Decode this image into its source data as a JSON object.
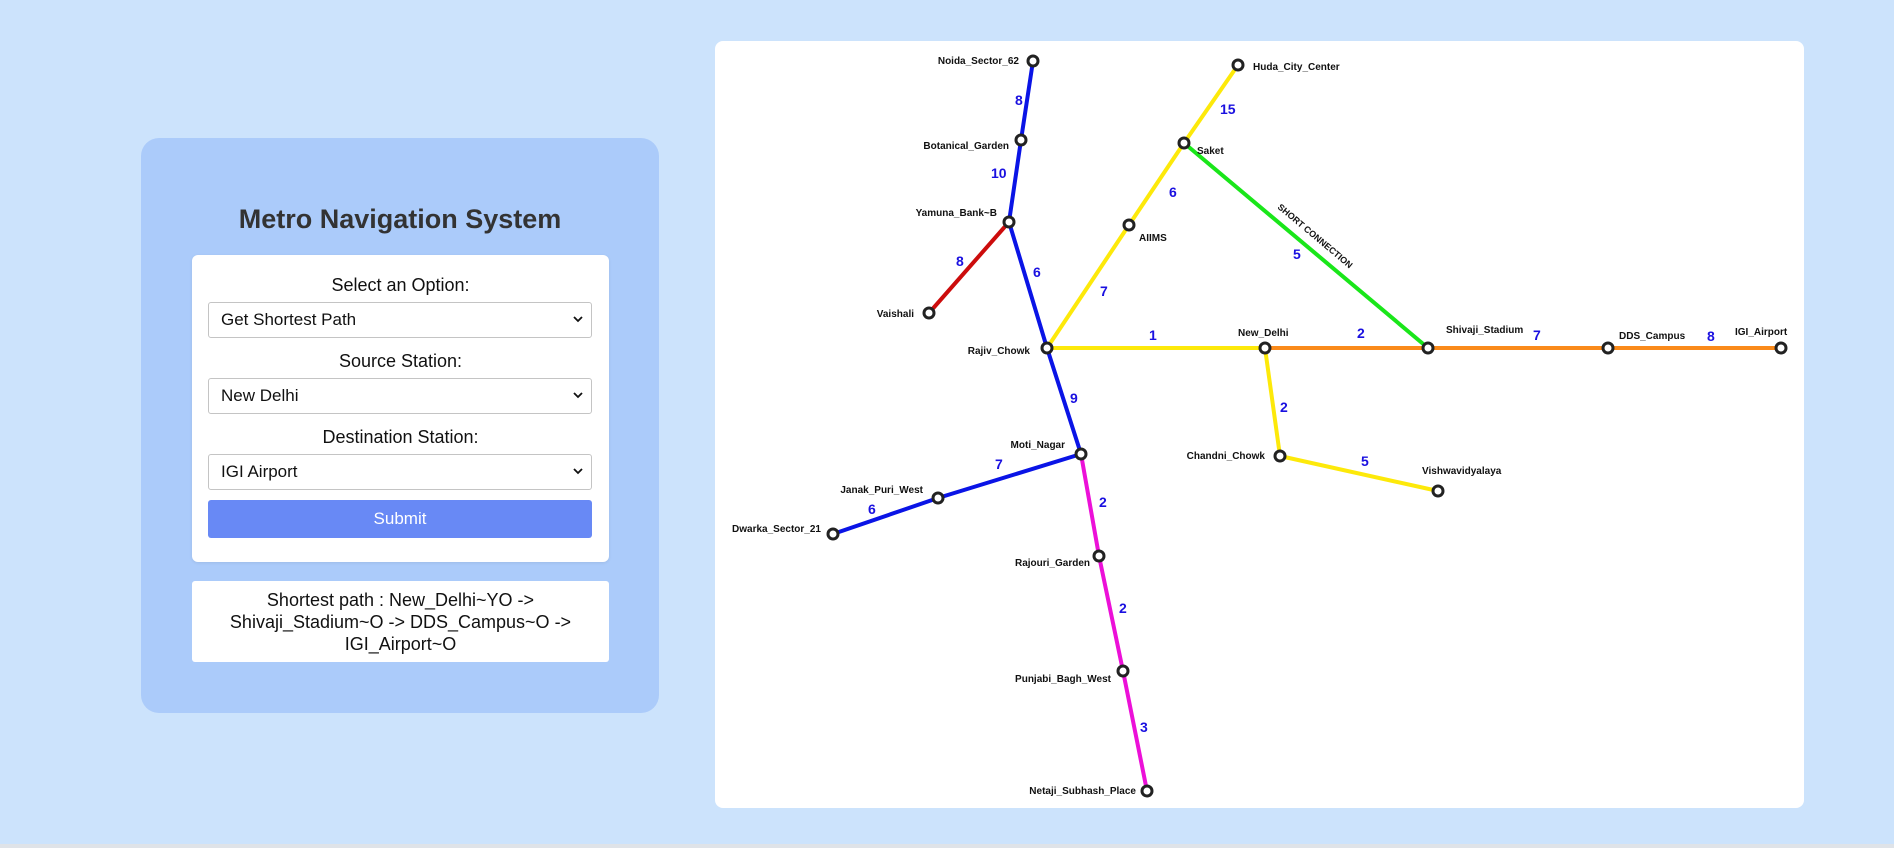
{
  "app": {
    "title": "Metro Navigation System"
  },
  "form": {
    "option_label": "Select an Option:",
    "option_value": "Get Shortest Path",
    "source_label": "Source Station:",
    "source_value": "New Delhi",
    "destination_label": "Destination Station:",
    "destination_value": "IGI Airport",
    "submit_label": "Submit"
  },
  "result": {
    "line1": "Shortest path : New_Delhi~YO ->",
    "line2": "Shivaji_Stadium~O -> DDS_Campus~O ->",
    "line3": "IGI_Airport~O"
  },
  "colors": {
    "page_bg": "#cce3fc",
    "panel_bg": "#abcbfa",
    "submit_bg": "#6889f5",
    "blue_line": "#0a14e6",
    "yellow_line": "#fde90a",
    "orange_line": "#fa8a1a",
    "green_line": "#1ae61a",
    "red_line": "#cc0c0c",
    "pink_line": "#ec10d8",
    "weight_text": "#1a10e0"
  },
  "map": {
    "stations": {
      "noida_sector_62": "Noida_Sector_62",
      "botanical_garden": "Botanical_Garden",
      "yamuna_bank": "Yamuna_Bank~B",
      "vaishali": "Vaishali",
      "rajiv_chowk": "Rajiv_Chowk",
      "moti_nagar": "Moti_Nagar",
      "janak_puri_west": "Janak_Puri_West",
      "dwarka_sector_21": "Dwarka_Sector_21",
      "rajouri_garden": "Rajouri_Garden",
      "punjabi_bagh_west": "Punjabi_Bagh_West",
      "netaji_subhash_place": "Netaji_Subhash_Place",
      "huda_city_center": "Huda_City_Center",
      "saket": "Saket",
      "aiims": "AIIMS",
      "new_delhi": "New_Delhi",
      "chandni_chowk": "Chandni_Chowk",
      "vishwavidyalaya": "Vishwavidyalaya",
      "shivaji_stadium": "Shivaji_Stadium",
      "dds_campus": "DDS_Campus",
      "igi_airport": "IGI_Airport"
    },
    "weights": {
      "noida_botanical": "8",
      "botanical_yamuna": "10",
      "yamuna_vaishali": "8",
      "yamuna_rajiv": "6",
      "rajiv_moti": "9",
      "moti_janak": "7",
      "janak_dwarka": "6",
      "moti_rajouri": "2",
      "rajouri_punjabi": "2",
      "punjabi_netaji": "3",
      "huda_saket": "15",
      "saket_aiims": "6",
      "aiims_rajiv": "7",
      "saket_shivaji": "5",
      "rajiv_newdelhi": "1",
      "newdelhi_shivaji": "2",
      "shivaji_dds": "7",
      "dds_igi": "8",
      "newdelhi_chandni": "2",
      "chandni_vishwa": "5"
    },
    "short_connection_label": "SHORT CONNECTION"
  }
}
